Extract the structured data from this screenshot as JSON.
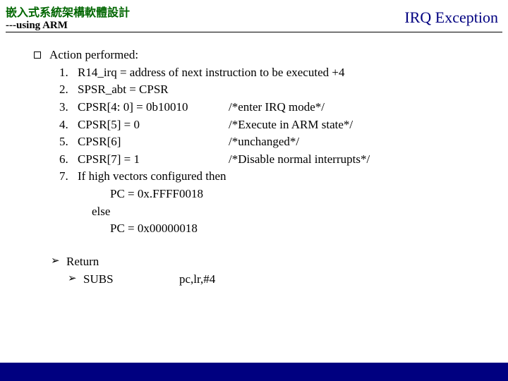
{
  "header": {
    "title_cn": "嵌入式系統架構軟體設計",
    "subtitle": "---using ARM",
    "topic": "IRQ Exception"
  },
  "action": {
    "heading": "Action performed:",
    "items": [
      {
        "n": "1.",
        "left": "R14_irq = address of next instruction to be executed +4",
        "right": ""
      },
      {
        "n": "2.",
        "left": "SPSR_abt = CPSR",
        "right": ""
      },
      {
        "n": "3.",
        "left": "CPSR[4: 0] = 0b10010",
        "right": "/*enter IRQ mode*/"
      },
      {
        "n": "4.",
        "left": "CPSR[5] = 0",
        "right": "/*Execute in ARM state*/"
      },
      {
        "n": "5.",
        "left": "CPSR[6]",
        "right": "/*unchanged*/"
      },
      {
        "n": "6.",
        "left": "CPSR[7] = 1",
        "right": "/*Disable normal interrupts*/"
      },
      {
        "n": "7.",
        "left": "If high vectors configured then",
        "right": ""
      }
    ],
    "pc_then": "PC = 0x.FFFF0018",
    "else": "else",
    "pc_else": "PC = 0x00000018"
  },
  "ret": {
    "label": "Return",
    "instr": "SUBS",
    "ops": "pc,lr,#4"
  },
  "glyph": {
    "tri": "➢"
  }
}
